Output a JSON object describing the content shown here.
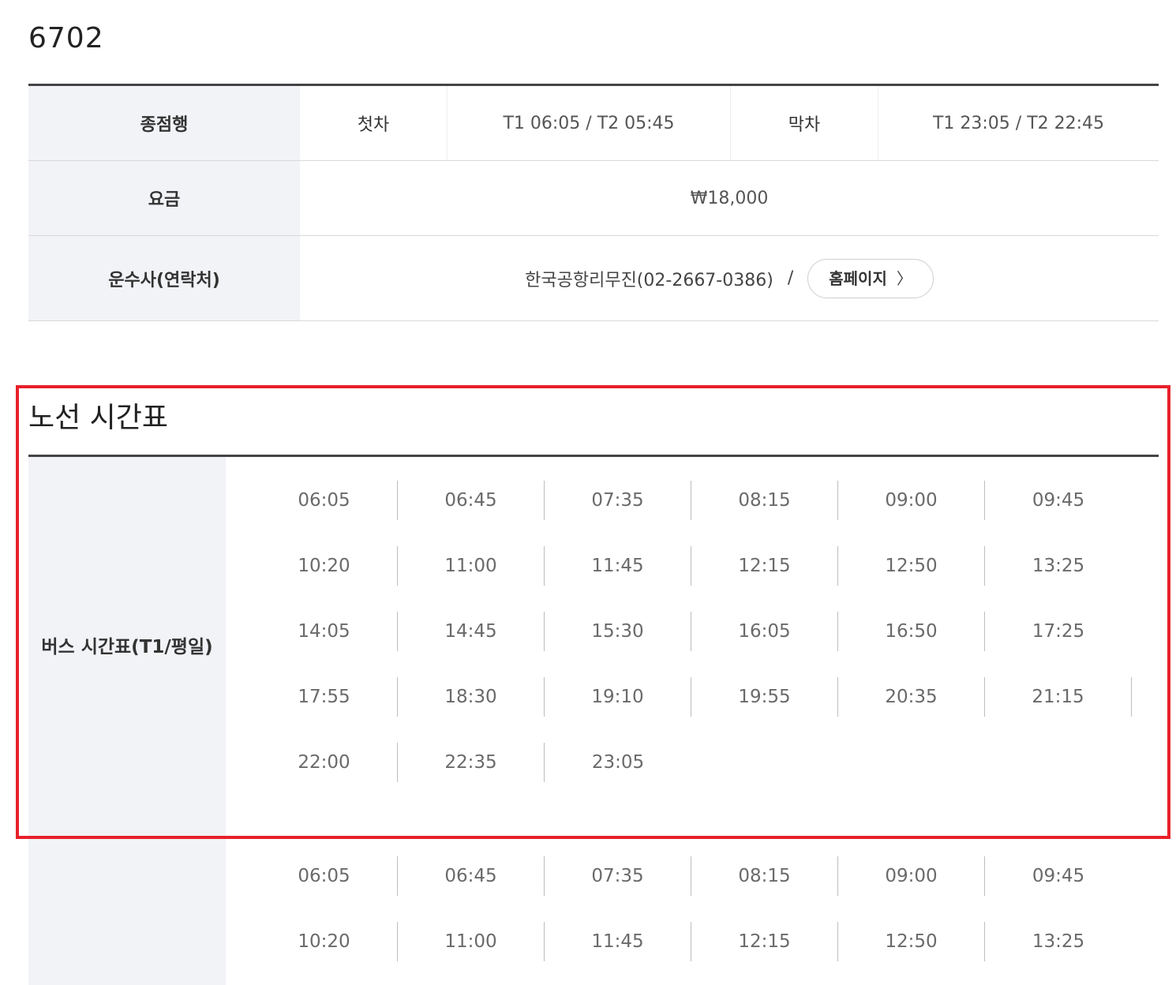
{
  "route_number": "6702",
  "info": {
    "destination_label": "종점행",
    "first_bus_label": "첫차",
    "first_bus_value": "T1 06:05 / T2 05:45",
    "last_bus_label": "막차",
    "last_bus_value": "T1 23:05 / T2 22:45",
    "fare_label": "요금",
    "fare_value": "₩18,000",
    "operator_label": "운수사(연락처)",
    "operator_value": "한국공항리무진(02-2667-0386)",
    "separator": "/",
    "homepage_button": "홈페이지",
    "homepage_chevron": "〉"
  },
  "timetable": {
    "section_title": "노선 시간표",
    "schedule_label": "버스 시간표(T1/평일)",
    "weekday_t1": [
      [
        "06:05",
        "06:45",
        "07:35",
        "08:15",
        "09:00",
        "09:45"
      ],
      [
        "10:20",
        "11:00",
        "11:45",
        "12:15",
        "12:50",
        "13:25"
      ],
      [
        "14:05",
        "14:45",
        "15:30",
        "16:05",
        "16:50",
        "17:25"
      ],
      [
        "17:55",
        "18:30",
        "19:10",
        "19:55",
        "20:35",
        "21:15"
      ],
      [
        "22:00",
        "22:35",
        "23:05"
      ]
    ],
    "next_schedule": [
      [
        "06:05",
        "06:45",
        "07:35",
        "08:15",
        "09:00",
        "09:45"
      ],
      [
        "10:20",
        "11:00",
        "11:45",
        "12:15",
        "12:50",
        "13:25"
      ]
    ]
  },
  "highlight_color": "#e8202a"
}
